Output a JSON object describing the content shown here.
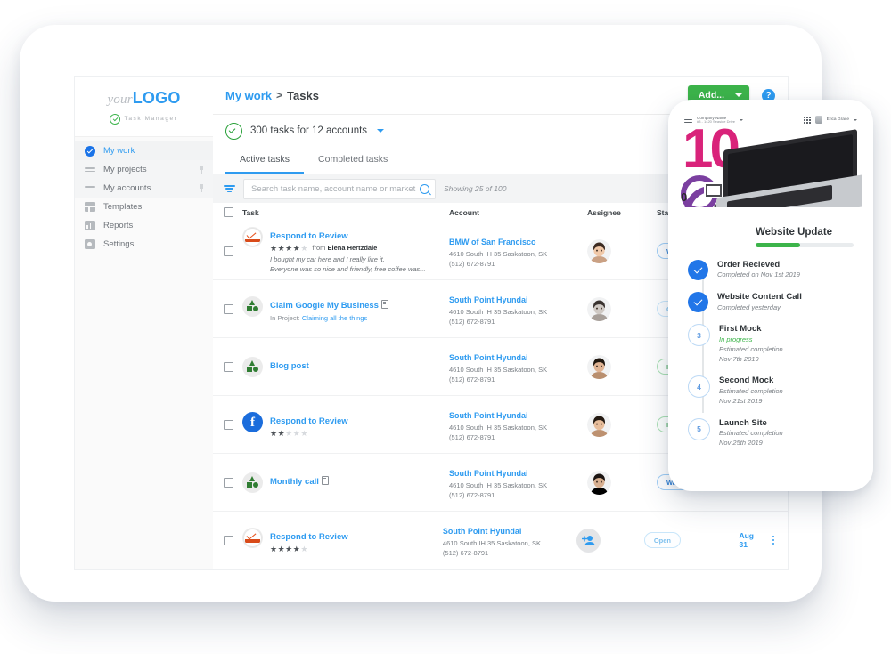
{
  "sidebar": {
    "logo_prefix": "your",
    "logo_main": "LOGO",
    "logo_sub": "Task Manager",
    "items": [
      {
        "label": "My work",
        "icon": "check-circle-icon"
      },
      {
        "label": "My projects",
        "icon": "lines-icon"
      },
      {
        "label": "My accounts",
        "icon": "lines-icon"
      },
      {
        "label": "Templates",
        "icon": "template-icon"
      },
      {
        "label": "Reports",
        "icon": "bar-chart-icon"
      },
      {
        "label": "Settings",
        "icon": "gear-icon"
      }
    ]
  },
  "topbar": {
    "breadcrumb_root": "My work",
    "breadcrumb_sep": ">",
    "breadcrumb_current": "Tasks",
    "add_label": "Add...",
    "help_label": "?"
  },
  "subbar": {
    "count_text": "300 tasks for 12 accounts"
  },
  "tabs": [
    {
      "label": "Active tasks",
      "active": true
    },
    {
      "label": "Completed tasks",
      "active": false
    }
  ],
  "filterbar": {
    "search_placeholder": "Search task name, account name or market",
    "search_value": "",
    "showing": "Showing 25 of 100",
    "views": [
      "calendar-view-icon",
      "card-view-icon",
      "list-view-icon"
    ]
  },
  "table": {
    "headers": [
      "Task",
      "Account",
      "Assignee",
      "Status"
    ],
    "rows": [
      {
        "icon": "review-badge-icon",
        "title": "Respond to Review",
        "stars_filled": 4,
        "stars_total": 5,
        "from_prefix": "from",
        "from_name": "Elena Hertzdale",
        "quote_line1": "I bought my car here and I really like it.",
        "quote_line2": "Everyone was so nice and friendly, free coffee was...",
        "account_name": "BMW of San Francisco",
        "account_addr": "4610 South IH 35 Saskatoon, SK",
        "account_phone": "(512) 672-8791",
        "status": "Waiting on customer",
        "status_kind": "wait",
        "avatar": "avatar-woman-1"
      },
      {
        "icon": "shapes-icon",
        "title": "Claim Google My Business",
        "has_doc": true,
        "subline_prefix": "In Project:",
        "subline_link": "Claiming all the things",
        "account_name": "South Point Hyundai",
        "account_addr": "4610 South IH 35 Saskatoon, SK",
        "account_phone": "(512) 672-8791",
        "status": "Open",
        "status_kind": "open",
        "avatar": "avatar-man-1"
      },
      {
        "icon": "shapes-icon",
        "title": "Blog post",
        "account_name": "South Point Hyundai",
        "account_addr": "4610 South IH 35 Saskatoon, SK",
        "account_phone": "(512) 672-8791",
        "status": "In progress",
        "status_kind": "prog",
        "avatar": "avatar-man-2"
      },
      {
        "icon": "facebook-icon",
        "title": "Respond to Review",
        "stars_filled": 2,
        "stars_total": 5,
        "account_name": "South Point Hyundai",
        "account_addr": "4610 South IH 35 Saskatoon, SK",
        "account_phone": "(512) 672-8791",
        "status": "In progress",
        "status_kind": "prog",
        "avatar": "avatar-woman-2"
      },
      {
        "icon": "shapes-icon",
        "title": "Monthly call",
        "has_doc": true,
        "account_name": "South Point Hyundai",
        "account_addr": "4610 South IH 35 Saskatoon, SK",
        "account_phone": "(512) 672-8791",
        "status": "Waiting on customer",
        "status_kind": "wait",
        "avatar": "avatar-man-3"
      },
      {
        "icon": "review-badge-icon",
        "title": "Respond to Review",
        "stars_filled": 4,
        "stars_total": 5,
        "account_name": "South Point Hyundai",
        "account_addr": "4610 South IH 35 Saskatoon, SK",
        "account_phone": "(512) 672-8791",
        "status": "Open",
        "status_kind": "open",
        "avatar": "add-person-icon",
        "date": "Aug 31"
      }
    ]
  },
  "phone": {
    "company_name": "Company Name",
    "company_addr": "#3 - 1420 Seaside Drive",
    "user_name": "Erica Grace",
    "hero_number": "10",
    "hero_digit_left": "0",
    "hero_digit_right": "1",
    "project_title": "Website Update",
    "progress_percent": 45,
    "timeline": [
      {
        "state": "done",
        "marker": "check-icon",
        "title": "Order Recieved",
        "sub1": "Completed on Nov 1st 2019"
      },
      {
        "state": "done",
        "marker": "check-icon",
        "title": "Website Content Call",
        "sub1": "Completed yesterday"
      },
      {
        "state": "current",
        "marker": "3",
        "title": "First Mock",
        "status": "In progress",
        "sub1": "Estimated completion",
        "sub2": "Nov 7th 2019"
      },
      {
        "state": "pending",
        "marker": "4",
        "title": "Second Mock",
        "sub1": "Estimated completion",
        "sub2": "Nov 21st 2019"
      },
      {
        "state": "pending",
        "marker": "5",
        "title": "Launch Site",
        "sub1": "Estimated completion",
        "sub2": "Nov 25th 2019"
      }
    ]
  },
  "colors": {
    "accent_blue": "#2e9bf0",
    "green": "#3cb44a",
    "link_blue": "#1a73e8",
    "magenta": "#d9237a"
  }
}
